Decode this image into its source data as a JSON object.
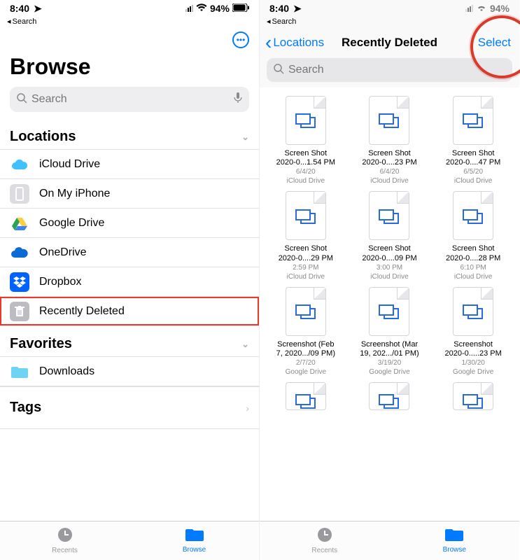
{
  "status": {
    "time": "8:40",
    "battery": "94%"
  },
  "backSearch": "Search",
  "left": {
    "title": "Browse",
    "search_placeholder": "Search",
    "sections": {
      "locations": {
        "header": "Locations",
        "items": [
          {
            "label": "iCloud Drive"
          },
          {
            "label": "On My iPhone"
          },
          {
            "label": "Google Drive"
          },
          {
            "label": "OneDrive"
          },
          {
            "label": "Dropbox"
          },
          {
            "label": "Recently Deleted"
          }
        ]
      },
      "favorites": {
        "header": "Favorites",
        "items": [
          {
            "label": "Downloads"
          }
        ]
      },
      "tags": {
        "header": "Tags"
      }
    }
  },
  "right": {
    "back_label": "Locations",
    "title": "Recently Deleted",
    "select_label": "Select",
    "search_placeholder": "Search",
    "files": [
      {
        "name1": "Screen Shot",
        "name2": "2020-0...1.54 PM",
        "sub1": "6/4/20",
        "sub2": "iCloud Drive"
      },
      {
        "name1": "Screen Shot",
        "name2": "2020-0....23 PM",
        "sub1": "6/4/20",
        "sub2": "iCloud Drive"
      },
      {
        "name1": "Screen Shot",
        "name2": "2020-0....47 PM",
        "sub1": "6/5/20",
        "sub2": "iCloud Drive"
      },
      {
        "name1": "Screen Shot",
        "name2": "2020-0....29 PM",
        "sub1": "2:59 PM",
        "sub2": "iCloud Drive"
      },
      {
        "name1": "Screen Shot",
        "name2": "2020-0....09 PM",
        "sub1": "3:00 PM",
        "sub2": "iCloud Drive"
      },
      {
        "name1": "Screen Shot",
        "name2": "2020-0....28 PM",
        "sub1": "6:10 PM",
        "sub2": "iCloud Drive"
      },
      {
        "name1": "Screenshot (Feb",
        "name2": "7, 2020.../09 PM)",
        "sub1": "2/7/20",
        "sub2": "Google Drive"
      },
      {
        "name1": "Screenshot (Mar",
        "name2": "19, 202.../01 PM)",
        "sub1": "3/19/20",
        "sub2": "Google Drive"
      },
      {
        "name1": "Screenshot",
        "name2": "2020-0.....23 PM",
        "sub1": "1/30/20",
        "sub2": "Google Drive"
      }
    ]
  },
  "tabs": {
    "recents": "Recents",
    "browse": "Browse"
  }
}
